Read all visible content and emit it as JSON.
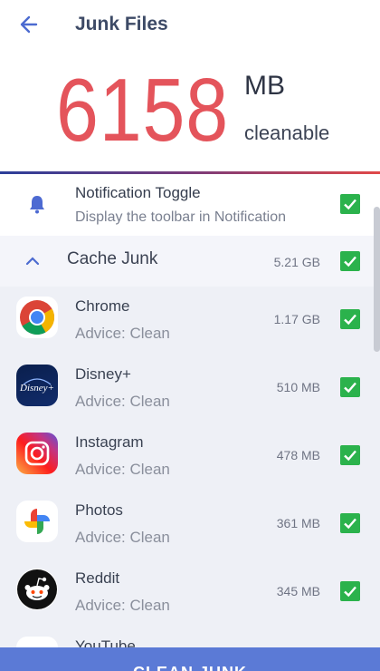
{
  "header": {
    "title": "Junk Files",
    "back_icon": "arrow-left-icon"
  },
  "summary": {
    "amount": "6158",
    "unit": "MB",
    "caption": "cleanable"
  },
  "notification": {
    "title": "Notification Toggle",
    "subtitle": "Display the toolbar in Notification",
    "checked": true,
    "icon": "bell-icon"
  },
  "cache": {
    "label": "Cache Junk",
    "size": "5.21 GB",
    "expanded": true,
    "checked": true
  },
  "apps": [
    {
      "name": "Chrome",
      "advice": "Advice: Clean",
      "size": "1.17 GB",
      "checked": true
    },
    {
      "name": "Disney+",
      "advice": "Advice: Clean",
      "size": "510 MB",
      "checked": true
    },
    {
      "name": "Instagram",
      "advice": "Advice: Clean",
      "size": "478 MB",
      "checked": true
    },
    {
      "name": "Photos",
      "advice": "Advice: Clean",
      "size": "361 MB",
      "checked": true
    },
    {
      "name": "Reddit",
      "advice": "Advice: Clean",
      "size": "345 MB",
      "checked": true
    },
    {
      "name": "YouTube",
      "advice": "",
      "size": "",
      "checked": true
    }
  ],
  "bottom": {
    "button_label": "CLEAN JUNK"
  },
  "colors": {
    "accent": "#5b7ad6",
    "amount": "#e4545b",
    "check": "#2bb24c"
  }
}
